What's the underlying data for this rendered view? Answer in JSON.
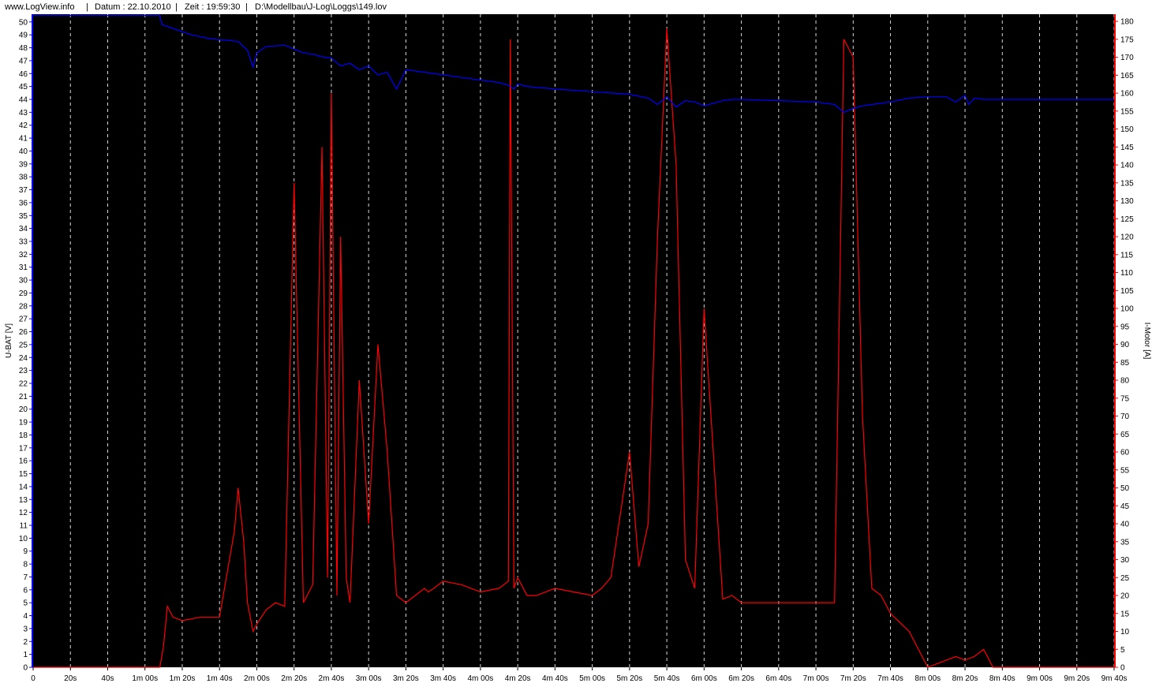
{
  "header": {
    "site": "www.LogView.info",
    "sep1": "|",
    "date": "Datum : 22.10.2010",
    "sep2": "|",
    "time": "Zeit : 19:59:30",
    "sep3": "|",
    "path": "D:\\Modellbau\\J-Log\\Loggs\\149.lov"
  },
  "chart_data": {
    "type": "line",
    "title": "",
    "xlabel": "",
    "x_unit": "s",
    "xlim": [
      0,
      580
    ],
    "x_tick_labels": [
      "0",
      "20s",
      "40s",
      "1m 00s",
      "1m 20s",
      "1m 40s",
      "2m 00s",
      "2m 20s",
      "2m 40s",
      "3m 00s",
      "3m 20s",
      "3m 40s",
      "4m 00s",
      "4m 20s",
      "4m 40s",
      "5m 00s",
      "5m 20s",
      "5m 40s",
      "6m 00s",
      "6m 20s",
      "6m 40s",
      "7m 00s",
      "7m 20s",
      "7m 40s",
      "8m 00s",
      "8m 20s",
      "8m 40s",
      "9m 00s",
      "9m 20s",
      "9m 40s"
    ],
    "grid": true,
    "background": "#000000",
    "y_left": {
      "label": "U-BAT [V]",
      "ylim": [
        0,
        50.6
      ],
      "color": "#0000ff"
    },
    "y_right": {
      "label": "I-Motor [A]",
      "ylim": [
        0,
        182
      ],
      "color": "#ff0000"
    },
    "series": [
      {
        "name": "U-BAT [V]",
        "axis": "left",
        "color": "#0000ff",
        "x": [
          0,
          68,
          69,
          75,
          85,
          95,
          110,
          115,
          118,
          120,
          125,
          135,
          140,
          145,
          150,
          155,
          160,
          165,
          170,
          175,
          180,
          185,
          190,
          195,
          200,
          210,
          220,
          230,
          240,
          250,
          255,
          258,
          260,
          265,
          280,
          300,
          320,
          330,
          335,
          340,
          345,
          350,
          355,
          360,
          370,
          375,
          380,
          400,
          420,
          430,
          435,
          440,
          445,
          450,
          455,
          460,
          470,
          480,
          490,
          495,
          500,
          502,
          505,
          510,
          580
        ],
        "y": [
          50.5,
          50.5,
          49.8,
          49.5,
          49.0,
          48.7,
          48.5,
          47.8,
          46.5,
          47.6,
          48.1,
          48.2,
          47.9,
          47.6,
          47.5,
          47.3,
          47.2,
          46.6,
          46.8,
          46.3,
          46.6,
          45.9,
          46.1,
          44.8,
          46.3,
          46.1,
          45.9,
          45.7,
          45.5,
          45.3,
          45.1,
          44.8,
          45.2,
          45.0,
          44.8,
          44.6,
          44.4,
          44.1,
          43.6,
          44.2,
          43.4,
          43.9,
          43.8,
          43.5,
          43.9,
          44.0,
          44.0,
          43.9,
          43.8,
          43.6,
          43.0,
          43.3,
          43.5,
          43.6,
          43.7,
          43.8,
          44.1,
          44.2,
          44.2,
          43.8,
          44.3,
          43.6,
          44.1,
          44.0,
          44.0
        ]
      },
      {
        "name": "I-Motor [A]",
        "axis": "right",
        "color": "#ff0000",
        "x": [
          0,
          68,
          70,
          72,
          75,
          80,
          90,
          100,
          108,
          110,
          113,
          115,
          118,
          120,
          125,
          130,
          135,
          140,
          145,
          150,
          155,
          158,
          160,
          163,
          165,
          168,
          170,
          175,
          180,
          185,
          190,
          195,
          200,
          205,
          210,
          212,
          215,
          220,
          230,
          240,
          250,
          255,
          256,
          258,
          260,
          265,
          270,
          280,
          290,
          300,
          305,
          310,
          320,
          325,
          330,
          335,
          340,
          345,
          350,
          355,
          360,
          370,
          375,
          380,
          400,
          420,
          430,
          435,
          440,
          445,
          450,
          455,
          460,
          470,
          480,
          490,
          495,
          500,
          505,
          510,
          515,
          520,
          530,
          540,
          550,
          560,
          570,
          580
        ],
        "y": [
          0,
          0,
          6,
          17,
          14,
          13,
          14,
          14,
          38,
          50,
          35,
          18,
          10,
          12,
          16,
          18,
          17,
          135,
          18,
          23,
          145,
          25,
          160,
          20,
          120,
          25,
          18,
          80,
          40,
          90,
          60,
          20,
          18,
          20,
          22,
          21,
          22,
          24,
          23,
          21,
          22,
          24,
          175,
          22,
          25,
          20,
          20,
          22,
          21,
          20,
          22,
          25,
          60,
          28,
          40,
          120,
          178,
          140,
          30,
          22,
          100,
          19,
          20,
          18,
          18,
          18,
          18,
          175,
          170,
          70,
          22,
          20,
          15,
          10,
          0,
          2,
          3,
          2,
          3,
          5,
          0,
          0,
          0,
          0,
          0,
          0,
          0,
          0
        ]
      }
    ]
  }
}
